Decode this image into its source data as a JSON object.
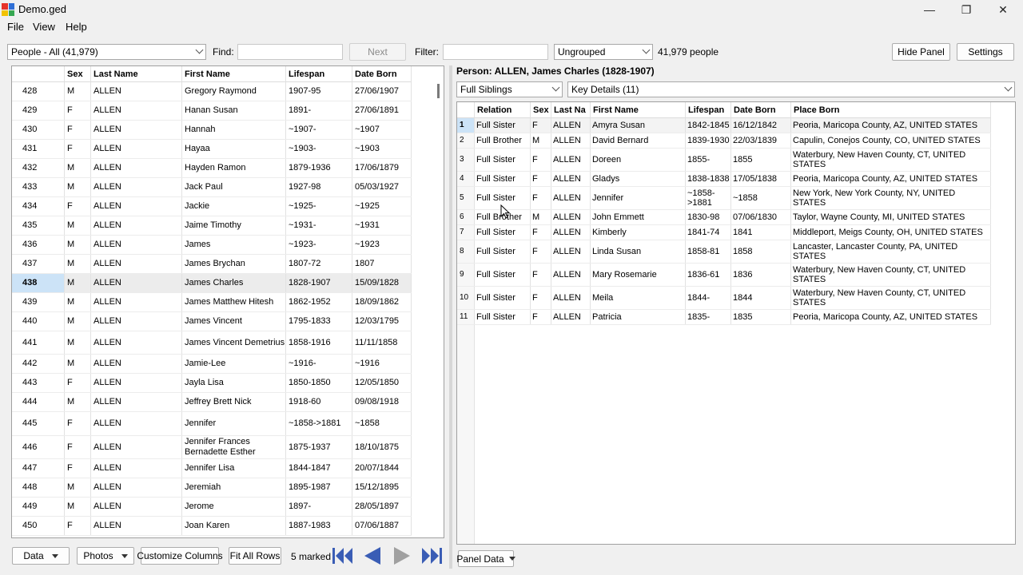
{
  "window": {
    "title": "Demo.ged",
    "minimize_glyph": "—",
    "maximize_glyph": "❐",
    "close_glyph": "✕"
  },
  "menu": [
    "File",
    "View",
    "Help"
  ],
  "toolbar": {
    "people_filter": "People - All (41,979)",
    "find_label": "Find:",
    "find_value": "",
    "next_label": "Next",
    "filter_label": "Filter:",
    "filter_value": "",
    "grouping": "Ungrouped",
    "people_count": "41,979 people",
    "hide_panel_label": "Hide Panel",
    "settings_label": "Settings"
  },
  "left_grid": {
    "columns": [
      "",
      "Sex",
      "Last Name",
      "First Name",
      "Lifespan",
      "Date Born"
    ],
    "sorted_column": "Last Name",
    "selected_row": "438",
    "rows": [
      [
        "428",
        "M",
        "ALLEN",
        "Gregory Raymond",
        "1907-95",
        "27/06/1907"
      ],
      [
        "429",
        "F",
        "ALLEN",
        "Hanan Susan",
        "1891-",
        "27/06/1891"
      ],
      [
        "430",
        "F",
        "ALLEN",
        "Hannah",
        "~1907-",
        "~1907"
      ],
      [
        "431",
        "F",
        "ALLEN",
        "Hayaa",
        "~1903-",
        "~1903"
      ],
      [
        "432",
        "M",
        "ALLEN",
        "Hayden Ramon",
        "1879-1936",
        "17/06/1879"
      ],
      [
        "433",
        "M",
        "ALLEN",
        "Jack Paul",
        "1927-98",
        "05/03/1927"
      ],
      [
        "434",
        "F",
        "ALLEN",
        "Jackie",
        "~1925-",
        "~1925"
      ],
      [
        "435",
        "M",
        "ALLEN",
        "Jaime Timothy",
        "~1931-",
        "~1931"
      ],
      [
        "436",
        "M",
        "ALLEN",
        "James",
        "~1923-",
        "~1923"
      ],
      [
        "437",
        "M",
        "ALLEN",
        "James Brychan",
        "1807-72",
        "1807"
      ],
      [
        "438",
        "M",
        "ALLEN",
        "James Charles",
        "1828-1907",
        "15/09/1828"
      ],
      [
        "439",
        "M",
        "ALLEN",
        "James Matthew Hitesh",
        "1862-1952",
        "18/09/1862"
      ],
      [
        "440",
        "M",
        "ALLEN",
        "James Vincent",
        "1795-1833",
        "12/03/1795"
      ],
      [
        "441",
        "M",
        "ALLEN",
        "James Vincent Demetrius",
        "1858-1916",
        "11/11/1858"
      ],
      [
        "442",
        "M",
        "ALLEN",
        "Jamie-Lee",
        "~1916-",
        "~1916"
      ],
      [
        "443",
        "F",
        "ALLEN",
        "Jayla Lisa",
        "1850-1850",
        "12/05/1850"
      ],
      [
        "444",
        "M",
        "ALLEN",
        "Jeffrey Brett Nick",
        "1918-60",
        "09/08/1918"
      ],
      [
        "445",
        "F",
        "ALLEN",
        "Jennifer",
        "~1858->1881",
        "~1858"
      ],
      [
        "446",
        "F",
        "ALLEN",
        "Jennifer Frances Bernadette Esther",
        "1875-1937",
        "18/10/1875"
      ],
      [
        "447",
        "F",
        "ALLEN",
        "Jennifer Lisa",
        "1844-1847",
        "20/07/1844"
      ],
      [
        "448",
        "M",
        "ALLEN",
        "Jeremiah",
        "1895-1987",
        "15/12/1895"
      ],
      [
        "449",
        "M",
        "ALLEN",
        "Jerome",
        "1897-",
        "28/05/1897"
      ],
      [
        "450",
        "F",
        "ALLEN",
        "Joan Karen",
        "1887-1983",
        "07/06/1887"
      ]
    ]
  },
  "right_panel": {
    "person_title": "Person: ALLEN, James Charles (1828-1907)",
    "relation_filter": "Full Siblings",
    "detail_view": "Key Details (11)",
    "columns": [
      "",
      "Relation",
      "Sex",
      "Last Na",
      "First Name",
      "Lifespan",
      "Date Born",
      "Place Born"
    ],
    "rows": [
      [
        "1",
        "Full Sister",
        "F",
        "ALLEN",
        "Amyra Susan",
        "1842-1845",
        "16/12/1842",
        "Peoria, Maricopa County, AZ, UNITED STATES"
      ],
      [
        "2",
        "Full Brother",
        "M",
        "ALLEN",
        "David Bernard",
        "1839-1930",
        "22/03/1839",
        "Capulin, Conejos County, CO, UNITED STATES"
      ],
      [
        "3",
        "Full Sister",
        "F",
        "ALLEN",
        "Doreen",
        "1855-",
        "1855",
        "Waterbury, New Haven County, CT, UNITED STATES"
      ],
      [
        "4",
        "Full Sister",
        "F",
        "ALLEN",
        "Gladys",
        "1838-1838",
        "17/05/1838",
        "Peoria, Maricopa County, AZ, UNITED STATES"
      ],
      [
        "5",
        "Full Sister",
        "F",
        "ALLEN",
        "Jennifer",
        "~1858->1881",
        "~1858",
        "New York, New York County, NY, UNITED STATES"
      ],
      [
        "6",
        "Full Brother",
        "M",
        "ALLEN",
        "John Emmett",
        "1830-98",
        "07/06/1830",
        "Taylor, Wayne County, MI, UNITED STATES"
      ],
      [
        "7",
        "Full Sister",
        "F",
        "ALLEN",
        "Kimberly",
        "1841-74",
        "1841",
        "Middleport, Meigs County, OH, UNITED STATES"
      ],
      [
        "8",
        "Full Sister",
        "F",
        "ALLEN",
        "Linda Susan",
        "1858-81",
        "1858",
        "Lancaster, Lancaster County, PA, UNITED STATES"
      ],
      [
        "9",
        "Full Sister",
        "F",
        "ALLEN",
        "Mary Rosemarie",
        "1836-61",
        "1836",
        "Waterbury, New Haven County, CT, UNITED STATES"
      ],
      [
        "10",
        "Full Sister",
        "F",
        "ALLEN",
        "Meila",
        "1844-",
        "1844",
        "Waterbury, New Haven County, CT, UNITED STATES"
      ],
      [
        "11",
        "Full Sister",
        "F",
        "ALLEN",
        "Patricia",
        "1835-",
        "1835",
        "Peoria, Maricopa County, AZ, UNITED STATES"
      ]
    ]
  },
  "bottom_bar": {
    "data_label": "Data",
    "photos_label": "Photos",
    "customize_label": "Customize Columns",
    "fit_rows_label": "Fit All Rows",
    "marked_text": "5 marked",
    "panel_data_label": "Panel Data"
  },
  "colors": {
    "selected_row_header": "#cce3f7",
    "nav_arrow": "#3a5db5",
    "nav_arrow_disabled": "#a0a0a0"
  }
}
